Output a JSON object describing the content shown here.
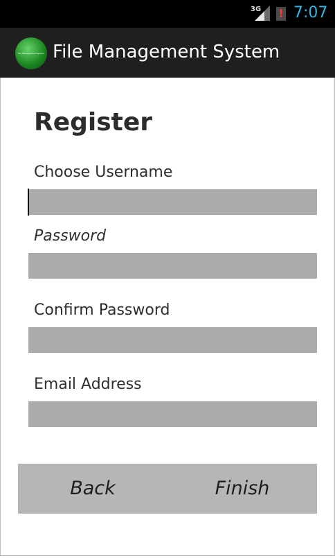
{
  "status_bar": {
    "network": "3G",
    "time": "7:07"
  },
  "app_bar": {
    "logo_text": "File Management System",
    "title": "File Management System"
  },
  "form": {
    "title": "Register",
    "fields": [
      {
        "label": "Choose Username",
        "value": ""
      },
      {
        "label": "Password",
        "value": ""
      },
      {
        "label": "Confirm Password",
        "value": ""
      },
      {
        "label": "Email Address",
        "value": ""
      }
    ]
  },
  "buttons": {
    "back": "Back",
    "finish": "Finish"
  },
  "colors": {
    "clock": "#33b5e5",
    "field": "#ababad",
    "buttons": "#b6b6b6"
  }
}
